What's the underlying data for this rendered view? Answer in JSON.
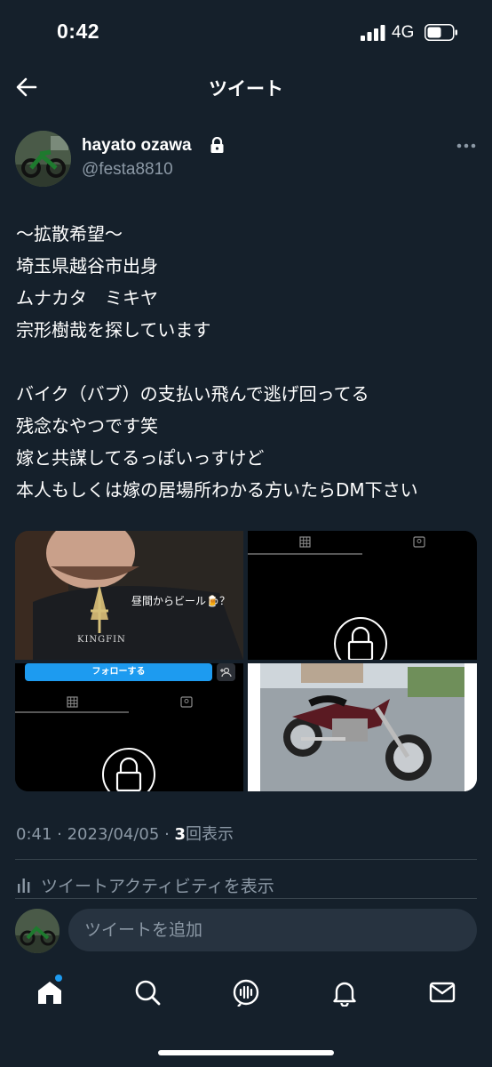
{
  "status_bar": {
    "time": "0:42",
    "network": "4G"
  },
  "header": {
    "title": "ツイート"
  },
  "author": {
    "name": "hayato ozawa",
    "handle": "@festa8810"
  },
  "tweet": {
    "lines": [
      "〜拡散希望〜",
      "埼玉県越谷市出身",
      "ムナカタ　ミキヤ",
      "宗形樹哉を探しています",
      "",
      "バイク（バブ）の支払い飛んで逃げ回ってる",
      "残念なやつです笑",
      "嫁と共謀してるっぽいっすけど",
      "本人もしくは嫁の居場所わかる方いたらDM下さい"
    ],
    "media": {
      "photo1_overlay": "昼間からビール🍺？",
      "photo1_brand": "KINGFIN",
      "follow_button": "フォローする"
    },
    "time": "0:41",
    "date": "2023/04/05",
    "views_count": "3",
    "views_label": "回表示"
  },
  "activity_label": "ツイートアクティビティを表示",
  "reply": {
    "placeholder": "ツイートを追加"
  },
  "colors": {
    "background": "#15202b",
    "accent": "#1d9bf0",
    "muted": "#8b98a5",
    "divider": "#38444d"
  },
  "nav": [
    "home-icon",
    "search-icon",
    "spaces-icon",
    "notifications-icon",
    "messages-icon"
  ]
}
